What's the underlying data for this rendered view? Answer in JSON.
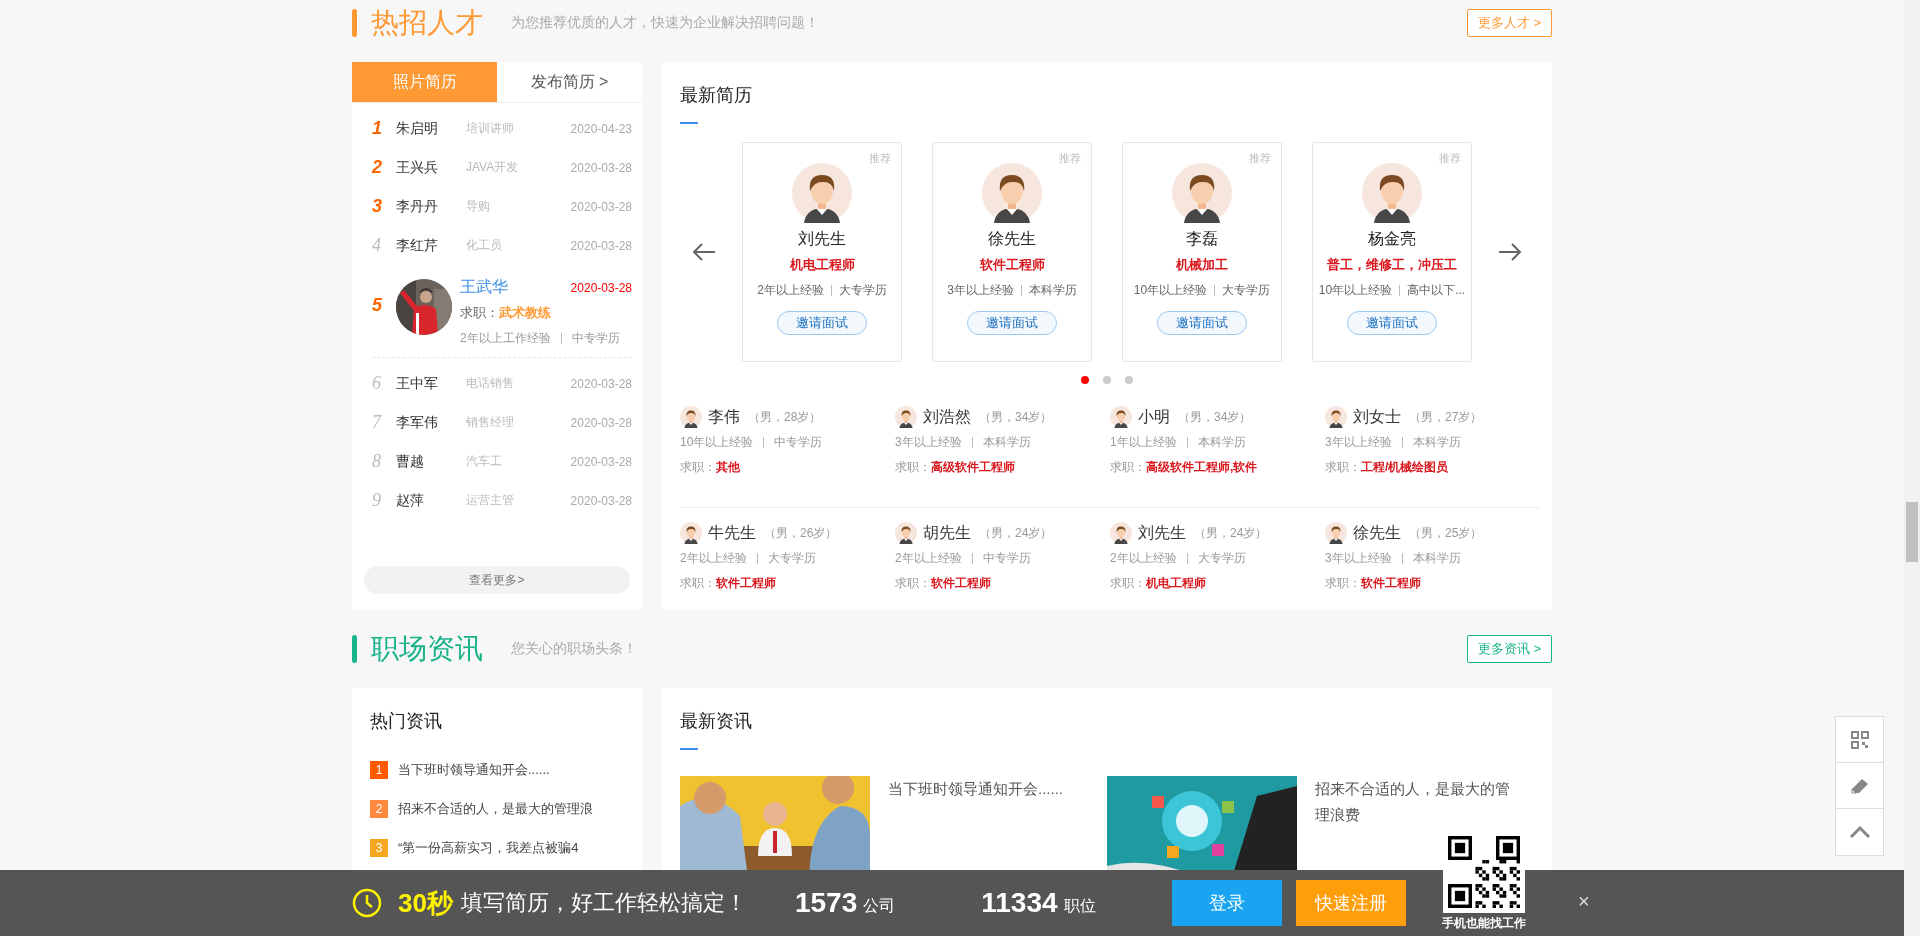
{
  "talent_section": {
    "title": "热招人才",
    "subtitle": "为您推荐优质的人才，快速为企业解决招聘问题！",
    "more_link": "更多人才 >"
  },
  "resume_tabs": [
    {
      "label": "照片简历",
      "selected": true
    },
    {
      "label": "发布简历 >",
      "selected": false
    }
  ],
  "ranking": [
    {
      "kind": "plain",
      "rank": "1",
      "highlighted": true,
      "name": "朱启明",
      "job": "培训讲师",
      "date": "2020-04-23"
    },
    {
      "kind": "plain",
      "rank": "2",
      "highlighted": true,
      "name": "王兴兵",
      "job": "JAVA开发",
      "date": "2020-03-28"
    },
    {
      "kind": "plain",
      "rank": "3",
      "highlighted": true,
      "name": "李丹丹",
      "job": "导购",
      "date": "2020-03-28"
    },
    {
      "kind": "plain",
      "rank": "4",
      "highlighted": false,
      "name": "李红芹",
      "job": "化工员",
      "date": "2020-03-28"
    },
    {
      "kind": "featured",
      "rank": "5",
      "highlighted": true,
      "name": "王武华",
      "date": "2020-03-28",
      "job_label": "求职：",
      "job": "武术教练",
      "experience": "2年以上工作经验",
      "education": "中专学历"
    },
    {
      "kind": "plain",
      "rank": "6",
      "highlighted": false,
      "name": "王中军",
      "job": "电话销售",
      "date": "2020-03-28"
    },
    {
      "kind": "plain",
      "rank": "7",
      "highlighted": false,
      "name": "李军伟",
      "job": "销售经理",
      "date": "2020-03-28"
    },
    {
      "kind": "plain",
      "rank": "8",
      "highlighted": false,
      "name": "曹越",
      "job": "汽车工",
      "date": "2020-03-28"
    },
    {
      "kind": "plain",
      "rank": "9",
      "highlighted": false,
      "name": "赵萍",
      "job": "运营主管",
      "date": "2020-03-28"
    }
  ],
  "view_more": "查看更多>",
  "latest_resumes": {
    "title": "最新简历",
    "cards": [
      {
        "tag": "推荐",
        "name": "刘先生",
        "job": "机电工程师",
        "experience": "2年以上经验",
        "education": "大专学历",
        "button": "邀请面试"
      },
      {
        "tag": "推荐",
        "name": "徐先生",
        "job": "软件工程师",
        "experience": "3年以上经验",
        "education": "本科学历",
        "button": "邀请面试"
      },
      {
        "tag": "推荐",
        "name": "李磊",
        "job": "机械加工",
        "experience": "10年以上经验",
        "education": "大专学历",
        "button": "邀请面试"
      },
      {
        "tag": "推荐",
        "name": "杨金亮",
        "job": "普工，维修工，冲压工",
        "experience": "10年以上经验",
        "education": "高中以下...",
        "button": "邀请面试"
      }
    ],
    "dots": [
      {
        "selected": true
      },
      {
        "selected": false
      },
      {
        "selected": false
      }
    ],
    "list": [
      {
        "name": "李伟",
        "info": "（男，28岁）",
        "experience": "10年以上经验",
        "education": "中专学历",
        "job_label": "求职：",
        "job": "其他"
      },
      {
        "name": "刘浩然",
        "info": "（男，34岁）",
        "experience": "3年以上经验",
        "education": "本科学历",
        "job_label": "求职：",
        "job": "高级软件工程师"
      },
      {
        "name": "小明",
        "info": "（男，34岁）",
        "experience": "1年以上经验",
        "education": "本科学历",
        "job_label": "求职：",
        "job": "高级软件工程师,软件"
      },
      {
        "name": "刘女士",
        "info": "（男，27岁）",
        "experience": "3年以上经验",
        "education": "本科学历",
        "job_label": "求职：",
        "job": "工程/机械绘图员"
      },
      {
        "name": "牛先生",
        "info": "（男，26岁）",
        "experience": "2年以上经验",
        "education": "大专学历",
        "job_label": "求职：",
        "job": "软件工程师"
      },
      {
        "name": "胡先生",
        "info": "（男，24岁）",
        "experience": "2年以上经验",
        "education": "中专学历",
        "job_label": "求职：",
        "job": "软件工程师"
      },
      {
        "name": "刘先生",
        "info": "（男，24岁）",
        "experience": "2年以上经验",
        "education": "大专学历",
        "job_label": "求职：",
        "job": "机电工程师"
      },
      {
        "name": "徐先生",
        "info": "（男，25岁）",
        "experience": "3年以上经验",
        "education": "本科学历",
        "job_label": "求职：",
        "job": "软件工程师"
      }
    ]
  },
  "news_section": {
    "title": "职场资讯",
    "subtitle": "您关心的职场头条！",
    "more_link": "更多资讯 >"
  },
  "hot_news": {
    "title": "热门资讯",
    "items": [
      {
        "rank": "1",
        "color": "#ff5a00",
        "title": "当下班时领导通知开会......"
      },
      {
        "rank": "2",
        "color": "#ff8a3d",
        "title": "招来不合适的人，是最大的管理浪"
      },
      {
        "rank": "3",
        "color": "#f5a623",
        "title": "“第一份高薪实习，我差点被骗4"
      }
    ]
  },
  "latest_news": {
    "title": "最新资讯",
    "items": [
      {
        "kind": "picture",
        "title": "当下班时领导通知开会......"
      },
      {
        "kind": "picture",
        "title": "招来不合适的人，是最大的管理浪费"
      }
    ]
  },
  "bottom_bar": {
    "highlight": "30秒",
    "slogan": "填写简历，好工作轻松搞定！",
    "companies": "1573",
    "companies_label": "公司",
    "jobs": "11334",
    "jobs_label": "职位",
    "login": "登录",
    "register": "快速注册",
    "qr_caption": "手机也能找工作",
    "close": "×"
  }
}
